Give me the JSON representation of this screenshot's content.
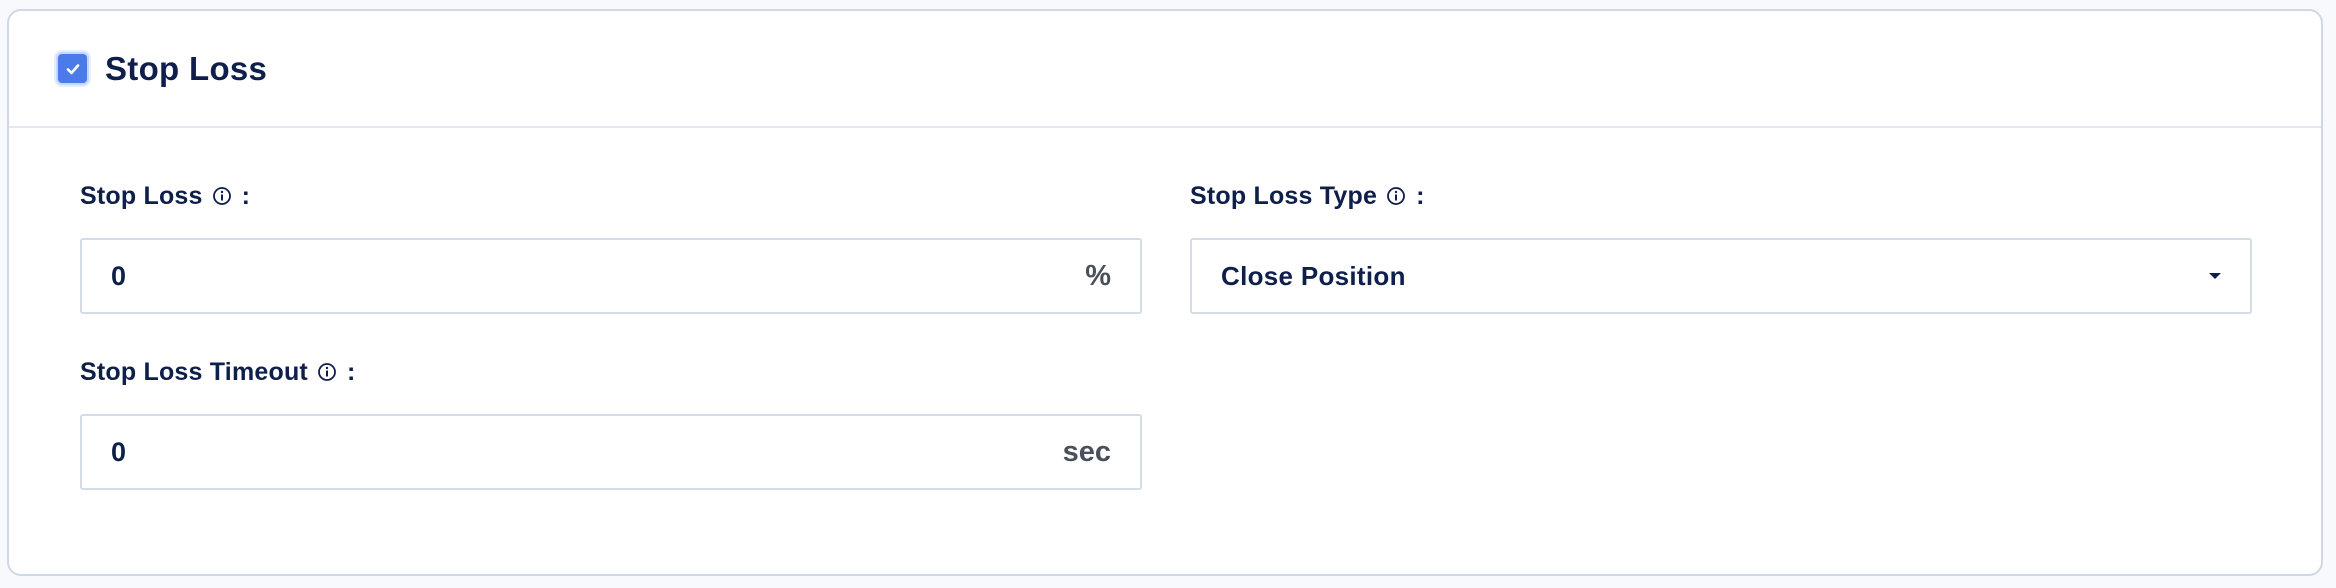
{
  "panel": {
    "title": "Stop Loss",
    "enabled": true,
    "accent_color": "#4a7be8"
  },
  "fields": {
    "stop_loss": {
      "label": "Stop Loss",
      "colon": ":",
      "value": "0",
      "suffix": "%",
      "icon": "info-icon"
    },
    "stop_loss_type": {
      "label": "Stop Loss Type",
      "colon": ":",
      "selected": "Close Position",
      "icon": "info-icon"
    },
    "stop_loss_timeout": {
      "label": "Stop Loss Timeout",
      "colon": ":",
      "value": "0",
      "suffix": "sec",
      "icon": "info-icon"
    }
  }
}
